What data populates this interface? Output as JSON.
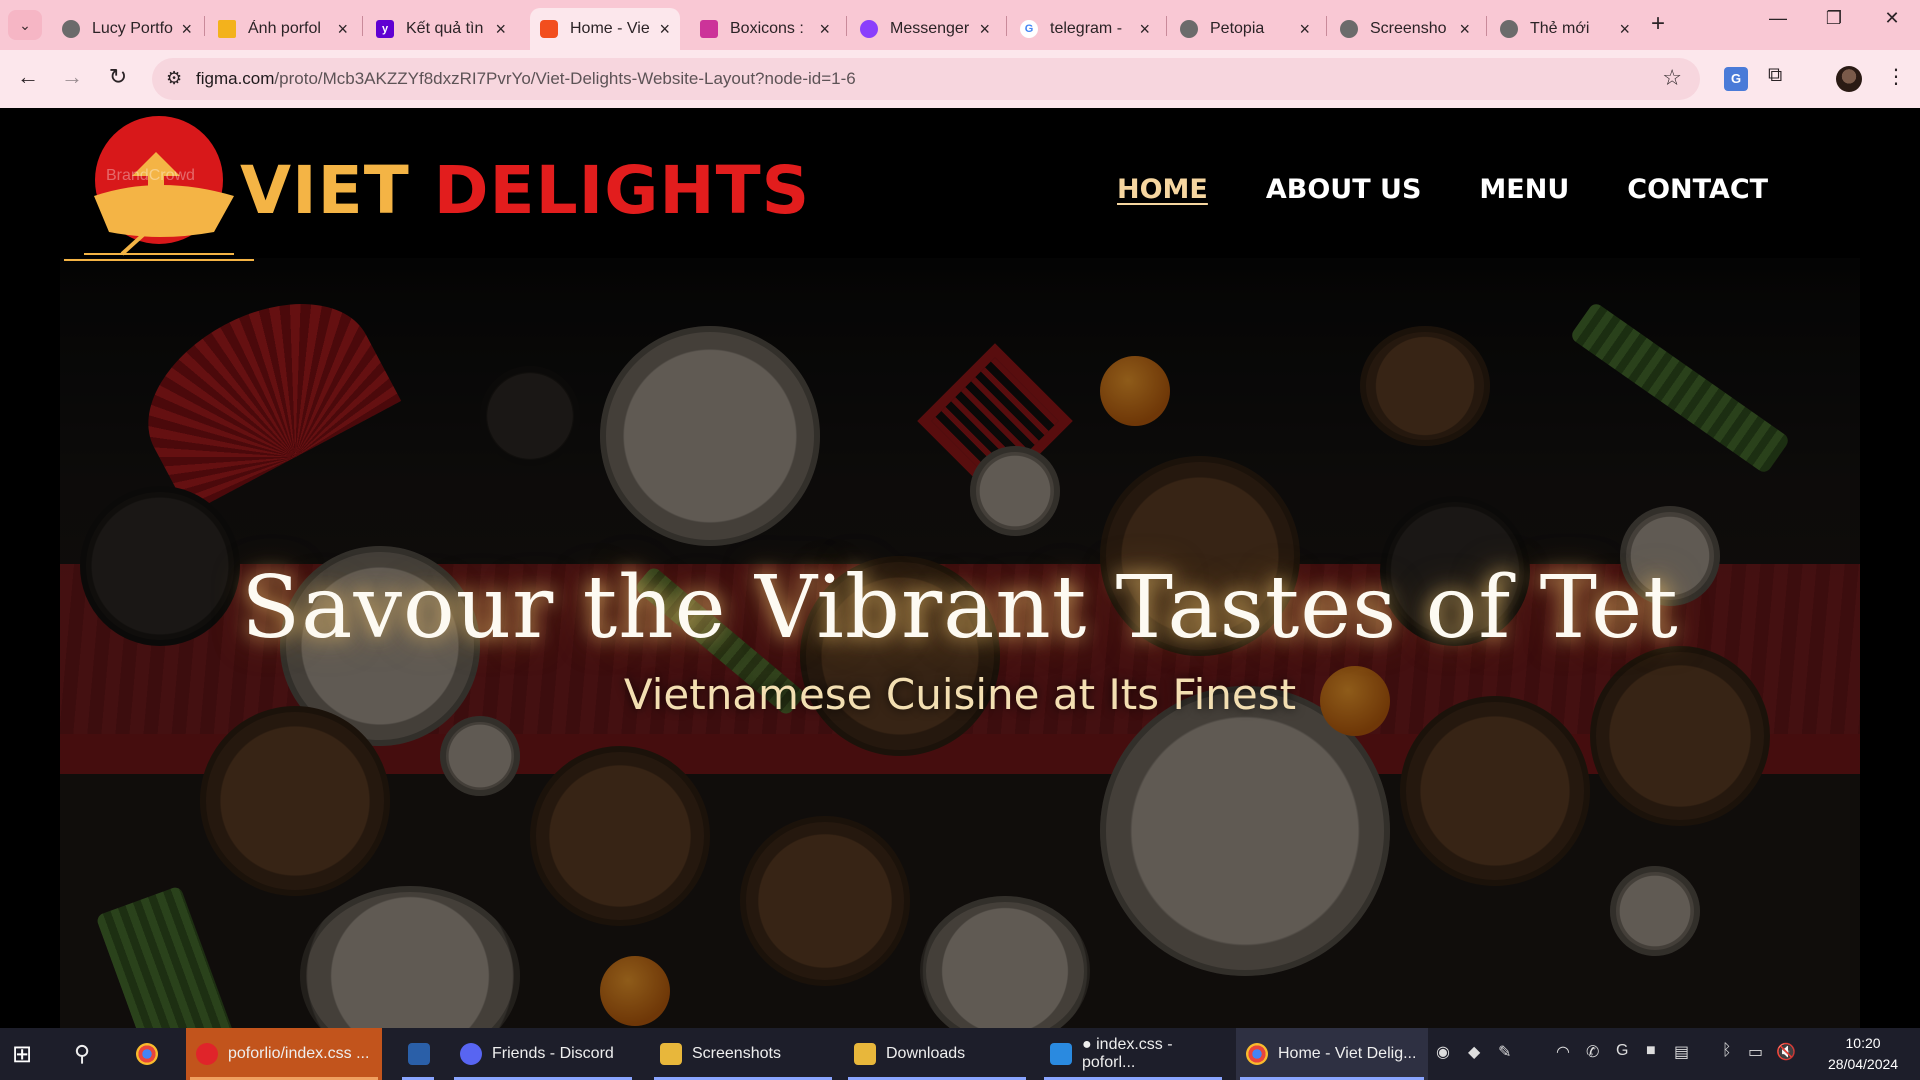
{
  "browser": {
    "tabs": [
      {
        "title": "Lucy Portfo",
        "favicon": "globe-icon",
        "color": "#6b6b6b"
      },
      {
        "title": "Ảnh porfol",
        "favicon": "drive-icon",
        "color": "#f3b21c"
      },
      {
        "title": "Kết quả tìn",
        "favicon": "yahoo-icon",
        "color": "#6001d2"
      },
      {
        "title": "Home - Vie",
        "favicon": "figma-icon",
        "color": "#f24e1e",
        "active": true
      },
      {
        "title": "Boxicons :",
        "favicon": "boxicons-icon",
        "color": "#cc3399"
      },
      {
        "title": "Messenger",
        "favicon": "messenger-icon",
        "color": "#8a3ffc"
      },
      {
        "title": "telegram -",
        "favicon": "google-icon",
        "color": "#4285f4"
      },
      {
        "title": "Petopia",
        "favicon": "globe-icon",
        "color": "#6b6b6b"
      },
      {
        "title": "Screensho",
        "favicon": "globe-icon",
        "color": "#6b6b6b"
      },
      {
        "title": "Thẻ mới",
        "favicon": "globe-icon",
        "color": "#6b6b6b"
      }
    ],
    "url_host": "figma.com",
    "url_path": "/proto/Mcb3AKZZYf8dxzRI7PvrYo/Viet-Delights-Website-Layout?node-id=1-6"
  },
  "site": {
    "logo_watermark": "BrandCrowd",
    "brand_viet": "VIET",
    "brand_delights": "DELIGHTS",
    "nav": [
      {
        "label": "HOME",
        "active": true
      },
      {
        "label": "ABOUT US"
      },
      {
        "label": "MENU"
      },
      {
        "label": "CONTACT"
      }
    ],
    "hero_title": "Savour the Vibrant Tastes of Tet",
    "hero_subtitle": "Vietnamese Cuisine at Its Finest",
    "colors": {
      "accent_gold": "#f4b445",
      "accent_red": "#e21d1d",
      "background": "#000000"
    }
  },
  "taskbar": {
    "apps": [
      {
        "label": "poforlio/index.css ...",
        "icon": "opera-icon",
        "color": "#e0242a",
        "highlight": true
      },
      {
        "label": "",
        "icon": "app-icon",
        "color": "#2a5fa8"
      },
      {
        "label": "Friends - Discord",
        "icon": "discord-icon",
        "color": "#5865f2"
      },
      {
        "label": "Screenshots",
        "icon": "folder-icon",
        "color": "#e8b73b"
      },
      {
        "label": "Downloads",
        "icon": "folder-icon",
        "color": "#e8b73b"
      },
      {
        "label": "● index.css - poforl...",
        "icon": "vscode-icon",
        "color": "#2a8ae0"
      },
      {
        "label": "Home - Viet Delig...",
        "icon": "chrome-icon",
        "color": "#3a8ee8"
      }
    ],
    "time": "10:20",
    "date": "28/04/2024"
  }
}
